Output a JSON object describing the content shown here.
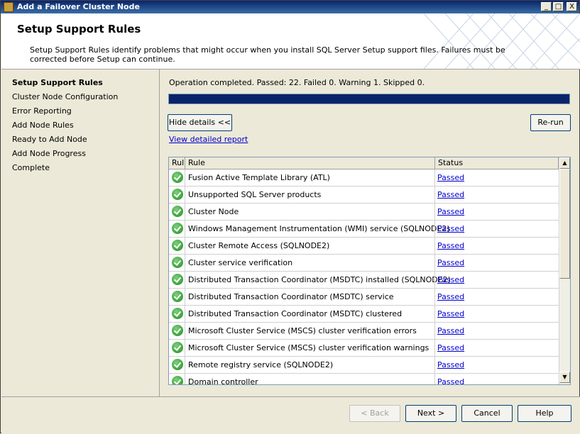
{
  "window": {
    "title": "Add a Failover Cluster Node",
    "minimize": "_",
    "maximize": "□",
    "close": "X"
  },
  "header": {
    "heading": "Setup Support Rules",
    "description": "Setup Support Rules identify problems that might occur when you install SQL Server Setup support files. Failures must be corrected before Setup can continue."
  },
  "nav": {
    "items": [
      {
        "label": "Setup Support Rules",
        "active": true
      },
      {
        "label": "Cluster Node Configuration"
      },
      {
        "label": "Error Reporting"
      },
      {
        "label": "Add Node Rules"
      },
      {
        "label": "Ready to Add Node"
      },
      {
        "label": "Add Node Progress"
      },
      {
        "label": "Complete"
      }
    ]
  },
  "operation": {
    "status_text": "Operation completed. Passed: 22.   Failed 0.   Warning 1.   Skipped 0.",
    "progress": 1.0
  },
  "buttons": {
    "hide_details": "Hide details <<",
    "rerun": "Re-run",
    "back": "< Back",
    "next": "Next >",
    "cancel": "Cancel",
    "help": "Help"
  },
  "links": {
    "view_report": "View detailed report"
  },
  "table": {
    "columns": [
      "Rul",
      "Rule",
      "Status"
    ],
    "rows": [
      {
        "rule": "Fusion Active Template Library (ATL)",
        "status": "Passed"
      },
      {
        "rule": "Unsupported SQL Server products",
        "status": "Passed"
      },
      {
        "rule": "Cluster Node",
        "status": "Passed"
      },
      {
        "rule": "Windows Management Instrumentation (WMI) service (SQLNODE2)",
        "status": "Passed"
      },
      {
        "rule": "Cluster Remote Access (SQLNODE2)",
        "status": "Passed"
      },
      {
        "rule": "Cluster service verification",
        "status": "Passed"
      },
      {
        "rule": "Distributed Transaction Coordinator (MSDTC) installed (SQLNODE2)",
        "status": "Passed"
      },
      {
        "rule": "Distributed Transaction Coordinator (MSDTC) service",
        "status": "Passed"
      },
      {
        "rule": "Distributed Transaction Coordinator (MSDTC) clustered",
        "status": "Passed"
      },
      {
        "rule": "Microsoft Cluster Service (MSCS) cluster verification errors",
        "status": "Passed"
      },
      {
        "rule": "Microsoft Cluster Service (MSCS) cluster verification warnings",
        "status": "Passed"
      },
      {
        "rule": "Remote registry service (SQLNODE2)",
        "status": "Passed"
      },
      {
        "rule": "Domain controller",
        "status": "Passed"
      }
    ]
  },
  "colors": {
    "title_bar": "#0a246a",
    "progress_fill": "#0a246a",
    "link": "#0000cc",
    "pass_icon": "#1e8c1e"
  },
  "icons": {
    "status_row": "check-circle-icon",
    "app": "setup-icon"
  }
}
